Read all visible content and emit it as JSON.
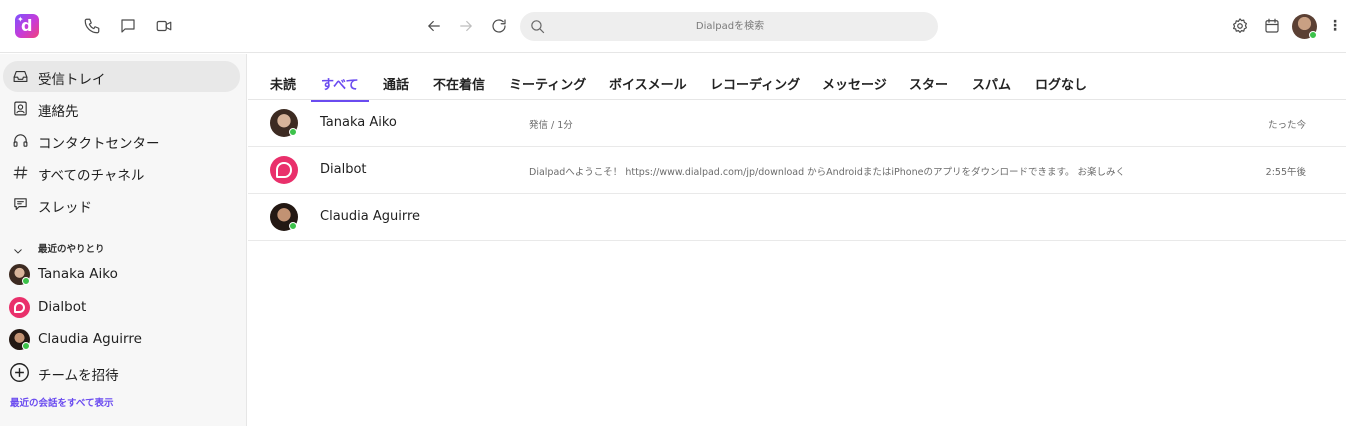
{
  "topbar": {
    "search_placeholder": "Dialpadを検索",
    "icons": [
      "phone-icon",
      "message-icon",
      "video-icon",
      "back-icon",
      "forward-icon",
      "refresh-icon",
      "search-icon",
      "settings-icon",
      "calendar-icon",
      "more-icon"
    ]
  },
  "sidebar": {
    "nav": [
      {
        "label": "受信トレイ",
        "icon": "inbox-icon",
        "active": true
      },
      {
        "label": "連絡先",
        "icon": "contacts-icon"
      },
      {
        "label": "コンタクトセンター",
        "icon": "headset-icon"
      },
      {
        "label": "すべてのチャネル",
        "icon": "hash-icon"
      },
      {
        "label": "スレッド",
        "icon": "threads-icon"
      }
    ],
    "recent_header": "最近のやりとり",
    "recent": [
      {
        "name": "Tanaka Aiko",
        "online": true
      },
      {
        "name": "Dialbot"
      },
      {
        "name": "Claudia Aguirre",
        "online": true
      }
    ],
    "invite_label": "チームを招待",
    "show_all_label": "最近の会話をすべて表示"
  },
  "tabs": [
    {
      "label": "未読"
    },
    {
      "label": "すべて",
      "active": true
    },
    {
      "label": "通話"
    },
    {
      "label": "不在着信"
    },
    {
      "label": "ミーティング"
    },
    {
      "label": "ボイスメール"
    },
    {
      "label": "レコーディング"
    },
    {
      "label": "メッセージ"
    },
    {
      "label": "スター"
    },
    {
      "label": "スパム"
    },
    {
      "label": "ログなし"
    }
  ],
  "conversations": [
    {
      "name": "Tanaka Aiko",
      "preview": "発信 / 1分",
      "time": "たった今"
    },
    {
      "name": "Dialbot",
      "preview": "Dialpadへようこそ！ https://www.dialpad.com/jp/download からAndroidまたはiPhoneのアプリをダウンロードできます。 お楽しみく",
      "time": "2:55午後"
    },
    {
      "name": "Claudia Aguirre",
      "preview": "",
      "time": ""
    }
  ],
  "colors": {
    "accent": "#6a4bf0",
    "online": "#3cc24a",
    "dialbot": "#e9306b"
  }
}
